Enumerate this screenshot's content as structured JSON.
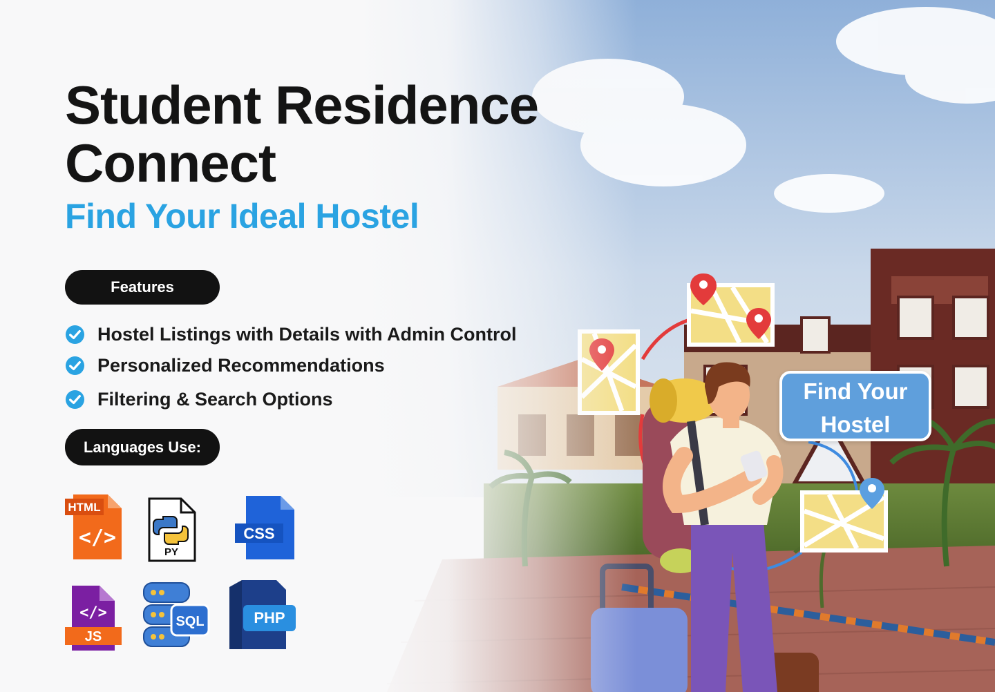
{
  "hero": {
    "title_line1": "Student Residence",
    "title_line2": "Connect",
    "subtitle": "Find Your Ideal Hostel"
  },
  "features": {
    "label": "Features",
    "items": [
      "Hostel Listings with Details with Admin Control",
      "Personalized Recommendations",
      "Filtering & Search Options"
    ]
  },
  "languages": {
    "label": "Languages Use:",
    "icons": [
      {
        "name": "html-icon",
        "text": "HTML",
        "glyph": "</>"
      },
      {
        "name": "python-icon",
        "text": "PY"
      },
      {
        "name": "css-icon",
        "text": "CSS"
      },
      {
        "name": "js-icon",
        "text": "JS",
        "glyph": "</>"
      },
      {
        "name": "sql-icon",
        "text": "SQL"
      },
      {
        "name": "php-icon",
        "text": "PHP"
      }
    ]
  },
  "bubble": {
    "line1": "Find Your",
    "line2": "Hostel"
  },
  "colors": {
    "accent": "#2aa3e2",
    "pill": "#121212",
    "bubble": "#5f9fdc",
    "html": "#f26a1b",
    "css": "#1f63d9",
    "js": "#7b1fa2",
    "php": "#1d5fb0"
  }
}
